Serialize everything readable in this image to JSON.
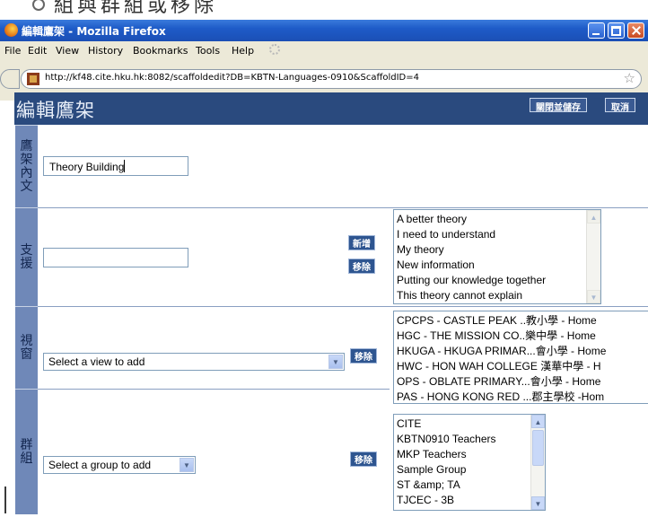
{
  "slide_caption": "組與群組或移除",
  "window": {
    "title": "編輯鷹架 - Mozilla Firefox"
  },
  "menu": [
    "File",
    "Edit",
    "View",
    "History",
    "Bookmarks",
    "Tools",
    "Help"
  ],
  "address": {
    "url": "http://kf48.cite.hku.hk:8082/scaffoldedit?DB=KBTN-Languages-0910&ScaffoldID=4"
  },
  "page": {
    "title": "編輯鷹架",
    "save_close_label": "關閉並儲存",
    "cancel_label": "取消"
  },
  "scaffold_content": {
    "label": "鷹架內文",
    "value": "Theory Building"
  },
  "supports": {
    "label": "支援",
    "input_value": "",
    "add_label": "新增",
    "remove_label": "移除",
    "items": [
      "A better theory",
      "I need to understand",
      "My theory",
      "New information",
      "Putting our knowledge together",
      "This theory cannot explain"
    ]
  },
  "views": {
    "label": "視窗",
    "select_value": "Select a view to add",
    "remove_label": "移除",
    "items": [
      "CPCPS - CASTLE PEAK ..教小學 - Home",
      "HGC - THE MISSION CO..樂中學 - Home",
      "HKUGA - HKUGA PRIMAR...會小學 - Home",
      "HWC - HON WAH COLLEGE 漢華中學 - H",
      "OPS - OBLATE PRIMARY...會小學 - Home",
      "PAS - HONG KONG RED ...郡主學校 -Hom"
    ]
  },
  "groups": {
    "label": "群組",
    "select_value": "Select a group to add",
    "remove_label": "移除",
    "items": [
      "CITE",
      "KBTN0910 Teachers",
      "MKP Teachers",
      "Sample Group",
      "ST &amp; TA",
      "TJCEC - 3B"
    ]
  }
}
